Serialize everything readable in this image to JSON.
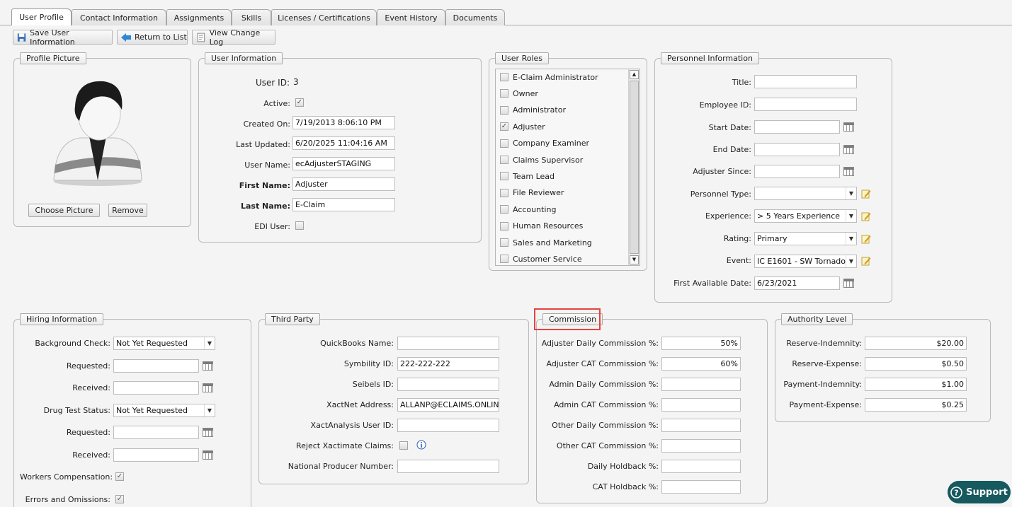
{
  "tabs": [
    "User Profile",
    "Contact Information",
    "Assignments",
    "Skills",
    "Licenses / Certifications",
    "Event History",
    "Documents"
  ],
  "toolbar": {
    "save": "Save User Information",
    "return": "Return to List",
    "changelog": "View Change Log"
  },
  "profile_picture": {
    "legend": "Profile Picture",
    "choose": "Choose Picture",
    "remove": "Remove"
  },
  "user_info": {
    "legend": "User Information",
    "user_id_label": "User ID:",
    "user_id": "3",
    "active_label": "Active:",
    "created_label": "Created On:",
    "created": "7/19/2013 8:06:10 PM",
    "updated_label": "Last Updated:",
    "updated": "6/20/2025 11:04:16 AM",
    "username_label": "User Name:",
    "username": "ecAdjusterSTAGING",
    "first_label": "First Name:",
    "first": "Adjuster",
    "last_label": "Last Name:",
    "last": "E-Claim",
    "edi_label": "EDI User:"
  },
  "user_roles": {
    "legend": "User Roles",
    "items": [
      "E-Claim Administrator",
      "Owner",
      "Administrator",
      "Adjuster",
      "Company Examiner",
      "Claims Supervisor",
      "Team Lead",
      "File Reviewer",
      "Accounting",
      "Human Resources",
      "Sales and Marketing",
      "Customer Service"
    ],
    "checked": [
      "Adjuster"
    ]
  },
  "personnel": {
    "legend": "Personnel Information",
    "title_label": "Title:",
    "title": "",
    "employee_label": "Employee ID:",
    "employee": "",
    "start_label": "Start Date:",
    "start": "",
    "end_label": "End Date:",
    "end": "",
    "since_label": "Adjuster Since:",
    "since": "",
    "type_label": "Personnel Type:",
    "type": "",
    "exp_label": "Experience:",
    "exp": "> 5 Years Experience",
    "rating_label": "Rating:",
    "rating": "Primary",
    "event_label": "Event:",
    "event": "IC E1601 - SW Tornado",
    "avail_label": "First Available Date:",
    "avail": "6/23/2021"
  },
  "hiring": {
    "legend": "Hiring Information",
    "bg_label": "Background Check:",
    "bg": "Not Yet Requested",
    "req1_label": "Requested:",
    "rec1_label": "Received:",
    "drug_label": "Drug Test Status:",
    "drug": "Not Yet Requested",
    "req2_label": "Requested:",
    "rec2_label": "Received:",
    "wc_label": "Workers Compensation:",
    "eo_label": "Errors and Omissions:"
  },
  "third_party": {
    "legend": "Third Party",
    "qb_label": "QuickBooks Name:",
    "qb": "",
    "sym_label": "Symbility ID:",
    "sym": "222-222-222",
    "seibels_label": "Seibels ID:",
    "seibels": "",
    "xact_label": "XactNet Address:",
    "xact": "ALLANP@ECLAIMS.ONLINE.T",
    "xa_label": "XactAnalysis User ID:",
    "xa": "",
    "reject_label": "Reject Xactimate Claims:",
    "npn_label": "National Producer Number:",
    "npn": ""
  },
  "commission": {
    "legend": "Commission",
    "rows": [
      {
        "label": "Adjuster Daily Commission %:",
        "value": "50%"
      },
      {
        "label": "Adjuster CAT Commission %:",
        "value": "60%"
      },
      {
        "label": "Admin Daily Commission %:",
        "value": ""
      },
      {
        "label": "Admin CAT Commission %:",
        "value": ""
      },
      {
        "label": "Other Daily Commission %:",
        "value": ""
      },
      {
        "label": "Other CAT Commission %:",
        "value": ""
      },
      {
        "label": "Daily Holdback %:",
        "value": ""
      },
      {
        "label": "CAT Holdback %:",
        "value": ""
      }
    ]
  },
  "authority": {
    "legend": "Authority Level",
    "rows": [
      {
        "label": "Reserve-Indemnity:",
        "value": "$20.00"
      },
      {
        "label": "Reserve-Expense:",
        "value": "$0.50"
      },
      {
        "label": "Payment-Indemnity:",
        "value": "$1.00"
      },
      {
        "label": "Payment-Expense:",
        "value": "$0.25"
      }
    ]
  },
  "support": "Support",
  "colors": {
    "highlight": "#e8413e",
    "support_bg": "#16595f"
  }
}
